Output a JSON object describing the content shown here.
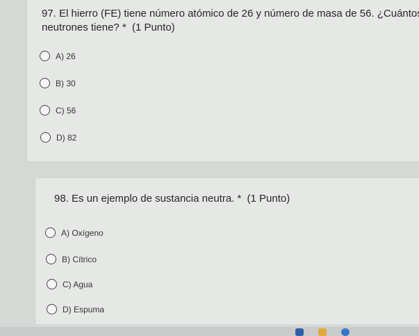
{
  "questions": [
    {
      "number_text": "97. El hierro (FE) tiene número atómico de 26 y número de masa de 56. ¿Cuántos neutrones tiene?",
      "required_mark": "*",
      "points": "(1 Punto)",
      "options": [
        {
          "label": "A) 26"
        },
        {
          "label": "B) 30"
        },
        {
          "label": "C) 56"
        },
        {
          "label": "D) 82"
        }
      ]
    },
    {
      "number_text": "98. Es un ejemplo de sustancia neutra.",
      "required_mark": "*",
      "points": "(1 Punto)",
      "options": [
        {
          "label": "A) Oxígeno"
        },
        {
          "label": "B) Cítrico"
        },
        {
          "label": "C) Agua"
        },
        {
          "label": "D) Espuma"
        }
      ]
    }
  ],
  "colors": {
    "background": "#d6d8d6",
    "card": "#e6e8e6",
    "text": "#262626"
  },
  "taskbar_icons": [
    "document-icon",
    "folder-icon",
    "chrome-icon"
  ]
}
